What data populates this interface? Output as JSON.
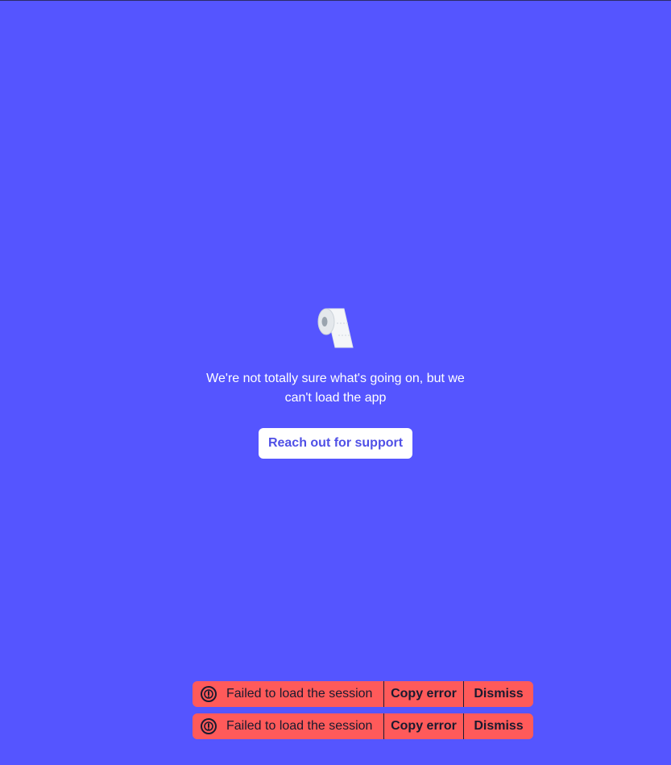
{
  "error_screen": {
    "illustration": "toilet-paper-roll-icon",
    "message": "We're not totally sure what's going on, but we can't load the app",
    "support_button_label": "Reach out for support"
  },
  "toasts": [
    {
      "icon": "alert-circle-icon",
      "text": "Failed to load the session",
      "copy_label": "Copy error",
      "dismiss_label": "Dismiss"
    },
    {
      "icon": "alert-circle-icon",
      "text": "Failed to load the session",
      "copy_label": "Copy error",
      "dismiss_label": "Dismiss"
    }
  ],
  "colors": {
    "background": "#5555ff",
    "button_background": "#ffffff",
    "button_text": "#5050e6",
    "toast_background": "#ff5a5a",
    "toast_text": "#1a1a2e"
  }
}
